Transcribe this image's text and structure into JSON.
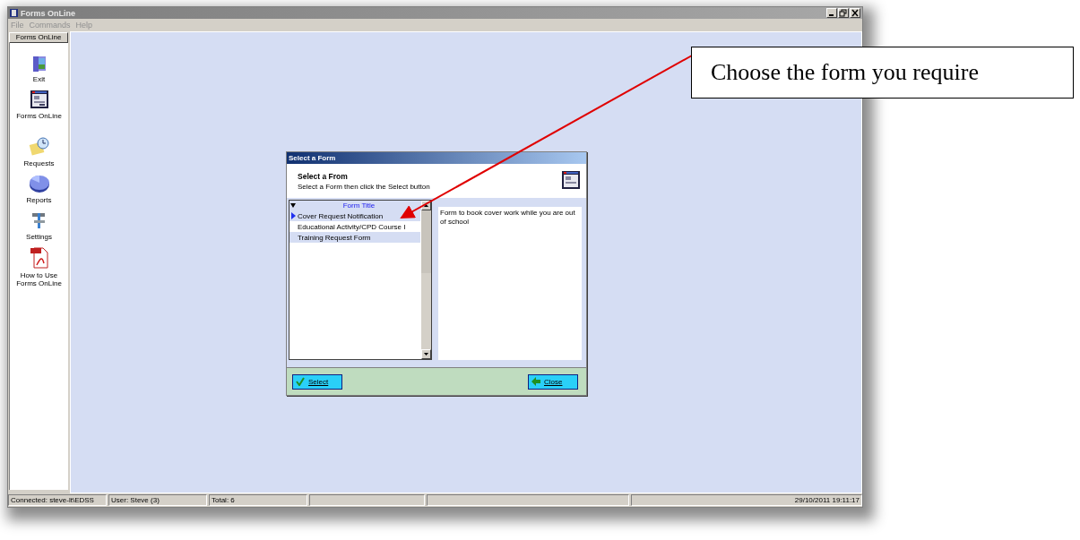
{
  "window": {
    "title": "Forms OnLine"
  },
  "menu": [
    {
      "label": "File",
      "disabled": true
    },
    {
      "label": "Commands",
      "disabled": true
    },
    {
      "label": "Help",
      "disabled": true
    }
  ],
  "sidebar": {
    "header": "Forms OnLine",
    "items": [
      {
        "label": "Exit",
        "kind": "exit"
      },
      {
        "label": "Forms OnLine",
        "kind": "forms"
      },
      {
        "label": "Requests",
        "kind": "requests"
      },
      {
        "label": "Reports",
        "kind": "reports"
      },
      {
        "label": "Settings",
        "kind": "settings"
      },
      {
        "label": "How to Use Forms OnLine",
        "kind": "pdf"
      }
    ]
  },
  "dialog": {
    "title": "Select a Form",
    "heading": "Select a From",
    "subtitle": "Select a Form then click the Select button",
    "list": {
      "column_header": "Form Title",
      "rows": [
        {
          "label": "Cover Request Notification",
          "selected": true
        },
        {
          "label": "Educational Activity/CPD Course I",
          "selected": false
        },
        {
          "label": "Training Request Form",
          "selected": false
        }
      ]
    },
    "description": "Form to book cover work while you are out of school",
    "buttons": [
      {
        "label": "Select",
        "kind": "select"
      },
      {
        "label": "Close",
        "kind": "close"
      }
    ]
  },
  "status_bar": {
    "fields": [
      "Connected: steve-lt\\EDSS",
      "User: Steve (3)",
      "Total: 6"
    ],
    "datetime": "29/10/2011 19:11:17"
  },
  "callout": {
    "text": "Choose the form you require"
  }
}
